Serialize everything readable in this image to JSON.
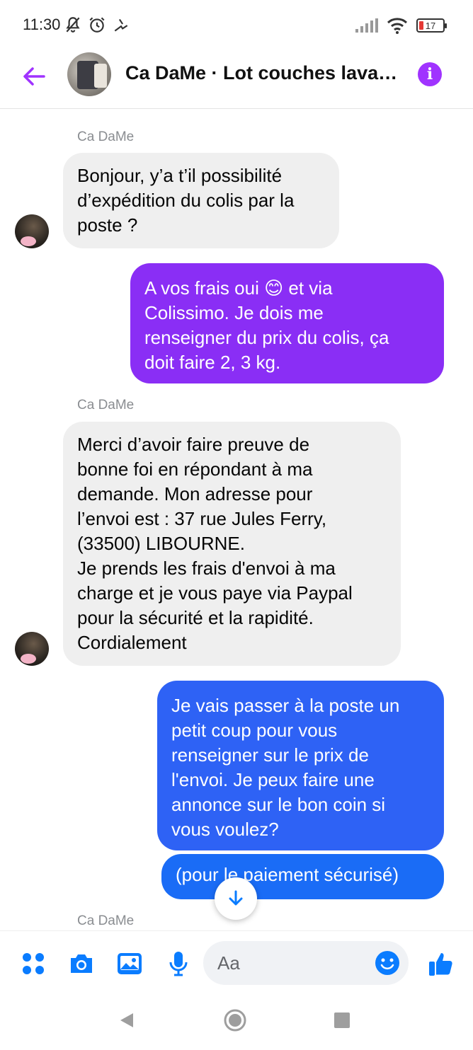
{
  "status_bar": {
    "time": "11:30",
    "battery": "17"
  },
  "header": {
    "title": "Ca DaMe · Lot couches lava…"
  },
  "messages": [
    {
      "direction": "in",
      "sender": "Ca DaMe",
      "text": "Bonjour, y’a t’il possibilité\nd’expédition du colis par la\nposte ?"
    },
    {
      "direction": "out",
      "text": "A vos frais oui 😊 et via\nColissimo. Je dois me\nrenseigner du prix du colis, ça\ndoit faire 2, 3 kg."
    },
    {
      "direction": "in",
      "sender": "Ca DaMe",
      "text": "Merci d’avoir faire preuve de\nbonne foi en répondant à ma\ndemande. Mon adresse pour\nl’envoi est : 37 rue Jules Ferry,\n(33500) LIBOURNE.\nJe prends les frais d'envoi à ma\ncharge et je vous paye via Paypal\npour la sécurité et la rapidité.\nCordialement"
    },
    {
      "direction": "out",
      "text": "Je vais passer à la poste un\npetit coup pour vous\nrenseigner sur le prix de\nl'envoi. Je peux faire une\nannonce sur le bon coin si\nvous voulez?"
    },
    {
      "direction": "out",
      "text": "(pour le paiement sécurisé)"
    },
    {
      "direction": "in",
      "sender": "Ca DaMe"
    }
  ],
  "composer": {
    "placeholder": "Aa"
  },
  "colors": {
    "accent": "#a033ff",
    "bubble_purple": "#8a2ef5",
    "bubble_blue": "#1a6cf6",
    "icon_blue": "#0a7cff",
    "bubble_in": "#efefef"
  },
  "icons": [
    "back-arrow-icon",
    "info-icon",
    "menu-dots-icon",
    "camera-icon",
    "gallery-icon",
    "microphone-icon",
    "emoji-icon",
    "thumbs-up-icon",
    "arrow-down-icon",
    "nav-back-icon",
    "nav-home-icon",
    "nav-recents-icon"
  ]
}
